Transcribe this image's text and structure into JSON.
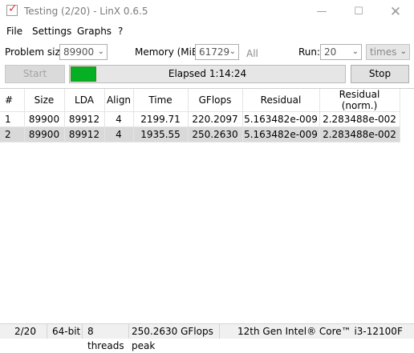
{
  "window": {
    "title": "Testing (2/20) - LinX 0.6.5"
  },
  "menu": [
    "File",
    "Settings",
    "Graphs",
    "?"
  ],
  "controls": {
    "problem_size_label": "Problem size:",
    "problem_size_value": "89900",
    "memory_label": "Memory (MiB):",
    "memory_value": "61729",
    "all_label": "All",
    "run_label": "Run:",
    "run_value": "20",
    "times_value": "times",
    "start_label": "Start",
    "stop_label": "Stop",
    "elapsed_text": "Elapsed 1:14:24",
    "progress_fraction": 0.1
  },
  "table": {
    "columns": [
      "#",
      "Size",
      "LDA",
      "Align",
      "Time",
      "GFlops",
      "Residual",
      "Residual (norm.)"
    ],
    "rows": [
      [
        "1",
        "89900",
        "89912",
        "4",
        "2199.71",
        "220.2097",
        "5.163482e-009",
        "2.283488e-002"
      ],
      [
        "2",
        "89900",
        "89912",
        "4",
        "1935.55",
        "250.2630",
        "5.163482e-009",
        "2.283488e-002"
      ]
    ],
    "selected_row": 1
  },
  "status": {
    "progress": "2/20",
    "bits": "64-bit",
    "threads": "8 threads",
    "peak": "250.2630 GFlops peak",
    "cpu": "12th Gen Intel® Core™ i3-12100F"
  },
  "colors": {
    "progress_fill": "#06b025",
    "selection": "#d9d9d9"
  }
}
